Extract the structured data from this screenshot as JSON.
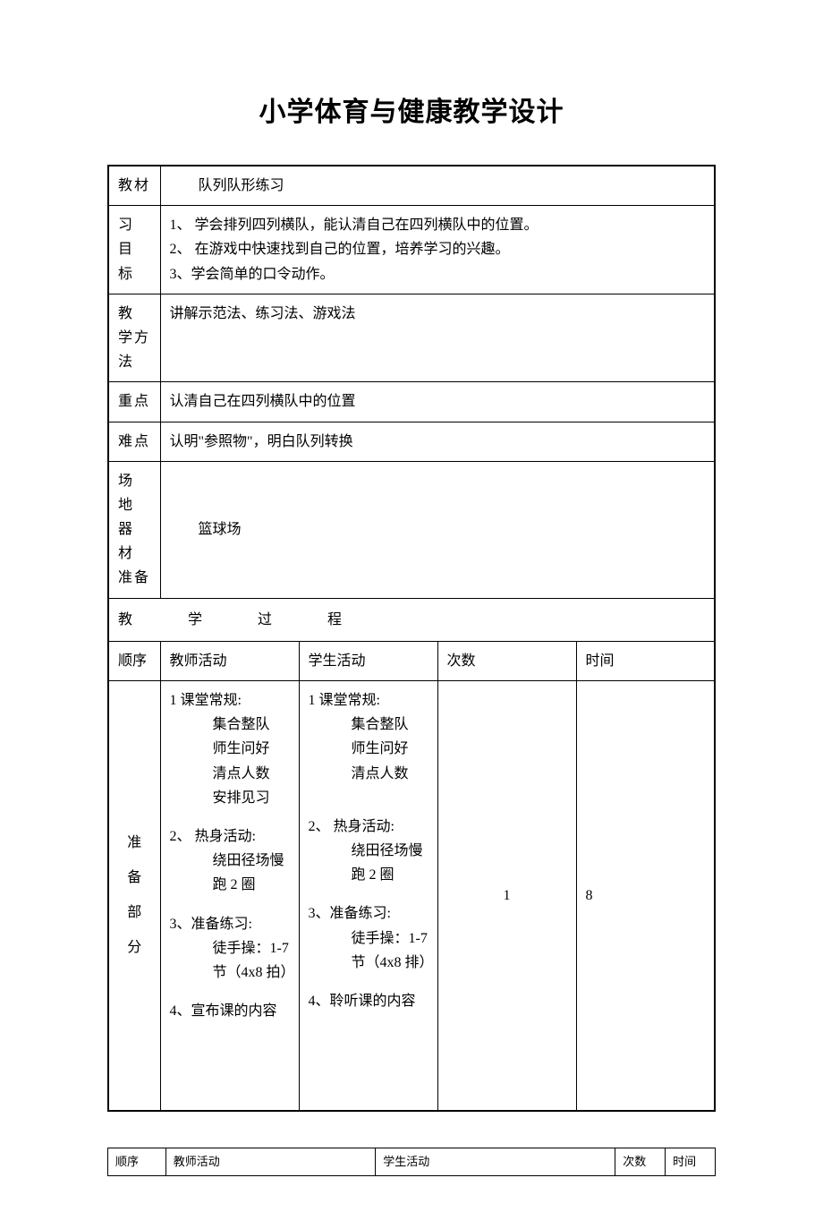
{
  "title": "小学体育与健康教学设计",
  "rows": {
    "material": {
      "label": "教材",
      "value": "　　队列队形练习"
    },
    "objectives": {
      "label_lines": [
        "习",
        "目",
        "标"
      ],
      "items": [
        "1、 学会排列四列横队，能认清自己在四列横队中的位置。",
        "2、 在游戏中快速找到自己的位置，培养学习的兴趣。",
        "3、学会简单的口令动作。"
      ]
    },
    "method": {
      "label": "教 学方法",
      "value": "讲解示范法、练习法、游戏法"
    },
    "keypoint": {
      "label": "重点",
      "value": "认清自己在四列横队中的位置"
    },
    "difficulty": {
      "label": "难点",
      "value": "认明\"参照物\"，明白队列转换"
    },
    "venue": {
      "label_lines": [
        "场 地",
        "器 材",
        "准备"
      ],
      "value": "　　篮球场"
    }
  },
  "process_header": "教　　学　　过　　程",
  "columns": {
    "order": "顺序",
    "teacher": "教师活动",
    "student": "学生活动",
    "count": "次数",
    "time": "时间"
  },
  "prep_section": {
    "label_lines": [
      "准",
      "备",
      "部",
      "分"
    ],
    "teacher": {
      "block1_title": "1 课堂常规:",
      "block1_items": [
        "集合整队",
        "师生问好",
        "清点人数",
        "安排见习"
      ],
      "block2_title": "2、 热身活动:",
      "block2_items": [
        "绕田径场慢跑 2 圈"
      ],
      "block3_title": "3、准备练习:",
      "block3_items": [
        "徒手操：1-7 节（4x8 拍）"
      ],
      "block4_title": "4、宣布课的内容"
    },
    "student": {
      "block1_title": "1 课堂常规:",
      "block1_items": [
        "集合整队",
        "师生问好",
        "清点人数"
      ],
      "block2_title": "2、 热身活动:",
      "block2_items": [
        "绕田径场慢跑 2 圈"
      ],
      "block3_title": "3、准备练习:",
      "block3_items": [
        "徒手操：1-7 节（4x8 排）"
      ],
      "block4_title": "4、聆听课的内容"
    },
    "count": "1",
    "time": "8"
  },
  "footer_columns": {
    "order": "顺序",
    "teacher": "教师活动",
    "student": "学生活动",
    "count": "次数",
    "time": "时间"
  }
}
